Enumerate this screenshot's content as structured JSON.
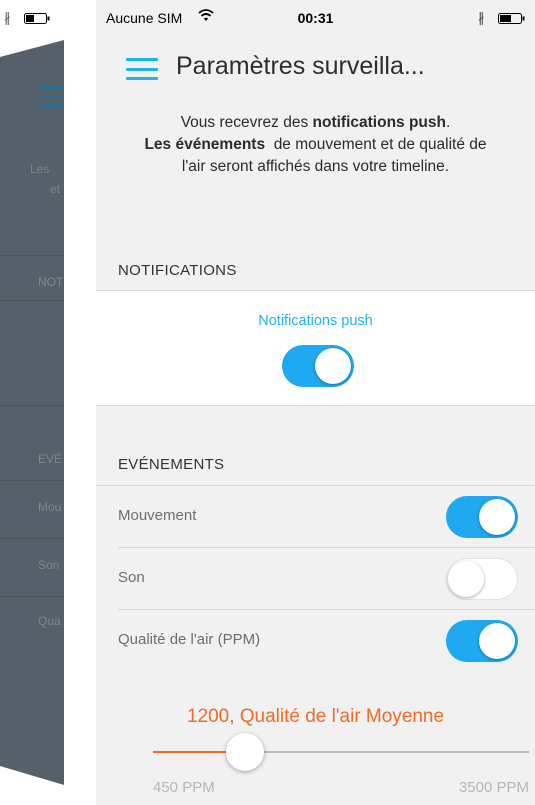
{
  "statusbar": {
    "carrier": "Aucune SIM",
    "time": "00:31",
    "icons": [
      "wifi-icon",
      "bluetooth-icon",
      "battery-icon"
    ]
  },
  "background_screen": {
    "fragments": [
      "Les",
      "et",
      "NOT",
      "EVÉ",
      "Mou",
      "Son",
      "Qua"
    ]
  },
  "header": {
    "title": "Paramètres surveilla..."
  },
  "intro": {
    "p1": "Vous recevrez des ",
    "b1": "notifications push",
    "p2": ".",
    "b2": "Les événements",
    "p3": "  de mouvement et de qualité de",
    "p4": "l'air seront affichés dans votre timeline."
  },
  "notifications": {
    "section_title": "NOTIFICATIONS",
    "push_label": "Notifications push",
    "push_enabled": true
  },
  "events": {
    "section_title": "EVÉNEMENTS",
    "items": [
      {
        "label": "Mouvement",
        "enabled": true
      },
      {
        "label": "Son",
        "enabled": false
      },
      {
        "label": "Qualité de l'air  (PPM)",
        "enabled": true
      }
    ]
  },
  "air_quality_slider": {
    "value_text": "1200, Qualité de l'air Moyenne",
    "min_label": "450 PPM",
    "max_label": "3500 PPM",
    "value": 1200,
    "min": 450,
    "max": 3500
  },
  "colors": {
    "accent_blue": "#1fa9f1",
    "accent_orange": "#f06a28",
    "background": "#f1f1f1"
  }
}
